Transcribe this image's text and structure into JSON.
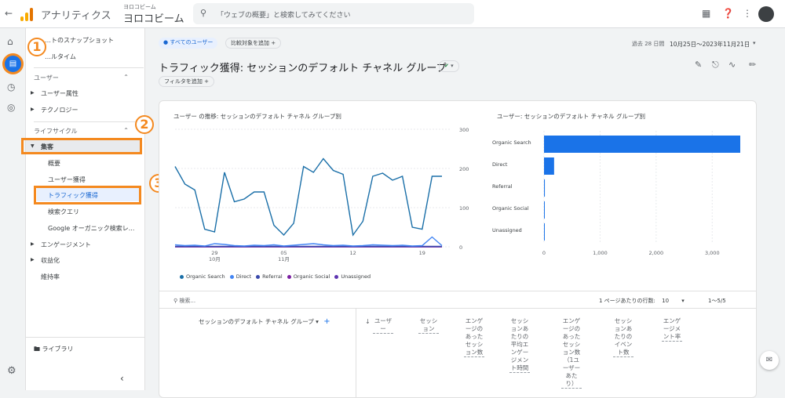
{
  "topbar": {
    "app_title": "アナリティクス",
    "property_small": "ヨロコビーム",
    "property_big": "ヨロコビーム",
    "search_placeholder": "「ウェブの概要」と検索してみてください"
  },
  "sidebar": {
    "items": [
      {
        "label": "…トのスナップショット"
      },
      {
        "label": "…ルタイム"
      },
      {
        "label": "ユーザー"
      },
      {
        "label": "ユーザー属性"
      },
      {
        "label": "テクノロジー"
      },
      {
        "label": "ライフサイクル"
      },
      {
        "label": "集客"
      },
      {
        "label": "概要"
      },
      {
        "label": "ユーザー獲得"
      },
      {
        "label": "トラフィック獲得"
      },
      {
        "label": "検索クエリ"
      },
      {
        "label": "Google オーガニック検索レ..."
      },
      {
        "label": "エンゲージメント"
      },
      {
        "label": "収益化"
      },
      {
        "label": "維持率"
      }
    ],
    "library": "ライブラリ"
  },
  "annotations": {
    "n1": "1",
    "n2": "2",
    "n3": "3"
  },
  "filters": {
    "segment": "すべてのユーザー",
    "compare": "比較対象を追加",
    "date_label": "過去 28 日間",
    "date_range": "10月25日～2023年11月21日",
    "add_filter": "フィルタを追加"
  },
  "page": {
    "title": "トラフィック獲得: セッションのデフォルト チャネル グループ"
  },
  "line_chart": {
    "title": "ユーザー の推移: セッションのデフォルト チャネル グループ別"
  },
  "bar_chart": {
    "title": "ユーザー: セッションのデフォルト チャネル グループ別"
  },
  "table": {
    "search_placeholder": "検索...",
    "rows_label": "1 ページあたりの行数:",
    "rows_value": "10",
    "range": "1～5/5",
    "dim_header": "セッションのデフォルト チャネル グループ",
    "columns": [
      "ユーザー",
      "セッション",
      "エンゲージのあったセッション数",
      "セッションあたりの平均エンゲージメント時間",
      "エンゲージのあったセッション数（1ユーザーあたり）",
      "セッションあたりのイベント数",
      "エンゲージメント率"
    ]
  },
  "chart_data": [
    {
      "type": "line",
      "title": "ユーザー の推移: セッションのデフォルト チャネル グループ別",
      "x_ticks": [
        "29",
        "05",
        "12",
        "19"
      ],
      "x_tick_sub": [
        "10月",
        "11月",
        "",
        ""
      ],
      "ylim": [
        0,
        300
      ],
      "y_ticks": [
        0,
        100,
        200,
        300
      ],
      "series": [
        {
          "name": "Organic Search",
          "color": "#1a6fa8",
          "values": [
            205,
            160,
            145,
            45,
            38,
            190,
            115,
            122,
            140,
            140,
            55,
            30,
            60,
            205,
            190,
            225,
            195,
            185,
            30,
            65,
            180,
            188,
            170,
            180,
            50,
            45,
            180,
            180
          ]
        },
        {
          "name": "Direct",
          "color": "#4285f4",
          "values": [
            5,
            3,
            4,
            2,
            8,
            6,
            3,
            2,
            4,
            3,
            5,
            2,
            4,
            6,
            8,
            5,
            3,
            4,
            2,
            3,
            5,
            4,
            3,
            4,
            2,
            3,
            25,
            3
          ]
        },
        {
          "name": "Referral",
          "color": "#3949ab",
          "values": [
            1,
            1,
            1,
            1,
            1,
            1,
            1,
            1,
            1,
            1,
            1,
            1,
            1,
            1,
            1,
            1,
            1,
            1,
            1,
            1,
            1,
            1,
            1,
            1,
            1,
            1,
            1,
            1
          ]
        },
        {
          "name": "Organic Social",
          "color": "#7b1fa2",
          "values": [
            0,
            0,
            0,
            0,
            0,
            0,
            0,
            0,
            0,
            0,
            0,
            0,
            0,
            0,
            0,
            0,
            0,
            0,
            0,
            0,
            0,
            0,
            0,
            0,
            0,
            0,
            0,
            0
          ]
        },
        {
          "name": "Unassigned",
          "color": "#5e35b1",
          "values": [
            0,
            0,
            0,
            0,
            0,
            0,
            0,
            0,
            0,
            0,
            0,
            0,
            0,
            0,
            0,
            0,
            0,
            0,
            0,
            0,
            0,
            0,
            0,
            0,
            0,
            0,
            0,
            0
          ]
        }
      ],
      "legend_position": "bottom-left"
    },
    {
      "type": "bar",
      "title": "ユーザー: セッションのデフォルト チャネル グループ別",
      "orientation": "horizontal",
      "categories": [
        "Organic Search",
        "Direct",
        "Referral",
        "Organic Social",
        "Unassigned"
      ],
      "values": [
        3500,
        180,
        15,
        2,
        1
      ],
      "xlim": [
        0,
        3500
      ],
      "x_ticks": [
        "0",
        "1,000",
        "2,000",
        "3,000"
      ],
      "color": "#1a73e8"
    }
  ]
}
